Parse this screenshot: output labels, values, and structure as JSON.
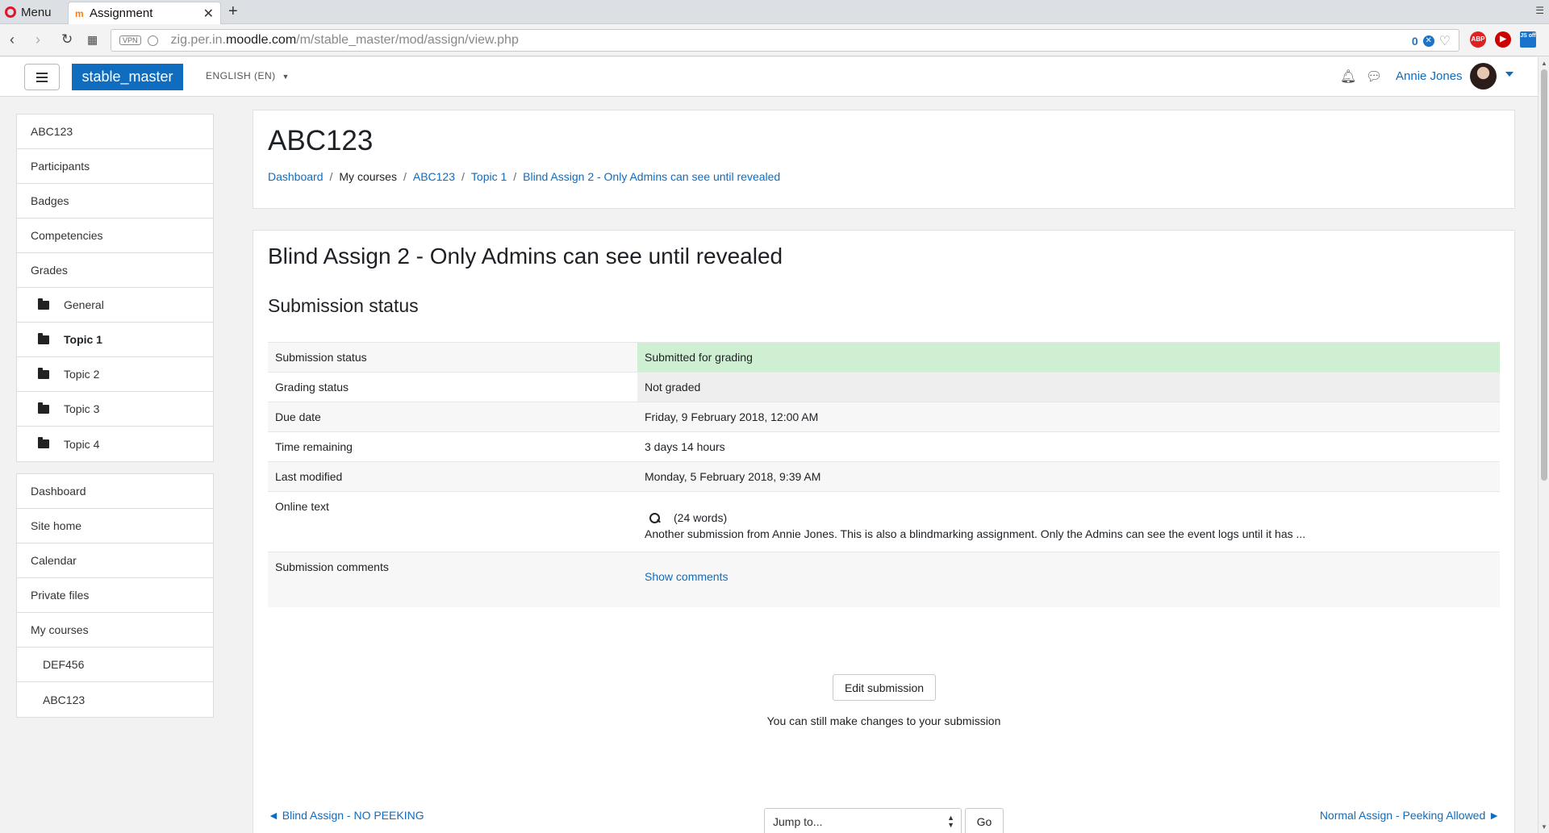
{
  "browser": {
    "menu_label": "Menu",
    "tab_title": "Assignment",
    "url_host_prefix": "zig.per.in.",
    "url_domain": "moodle.com",
    "url_path": "/m/stable_master/mod/assign/view.php",
    "vpn_label": "VPN",
    "blocked_count": "0",
    "ext_abp": "ABP",
    "ext_js": "JS off"
  },
  "navbar": {
    "brand": "stable_master",
    "language": "ENGLISH (EN)",
    "user_name": "Annie Jones"
  },
  "drawer": {
    "course_nav": [
      {
        "label": "ABC123"
      },
      {
        "label": "Participants"
      },
      {
        "label": "Badges"
      },
      {
        "label": "Competencies"
      },
      {
        "label": "Grades"
      },
      {
        "label": "General"
      },
      {
        "label": "Topic 1"
      },
      {
        "label": "Topic 2"
      },
      {
        "label": "Topic 3"
      },
      {
        "label": "Topic 4"
      }
    ],
    "site_nav": [
      {
        "label": "Dashboard"
      },
      {
        "label": "Site home"
      },
      {
        "label": "Calendar"
      },
      {
        "label": "Private files"
      },
      {
        "label": "My courses"
      },
      {
        "label": "DEF456"
      },
      {
        "label": "ABC123"
      }
    ]
  },
  "header": {
    "course_title": "ABC123",
    "breadcrumb": [
      "Dashboard",
      "My courses",
      "ABC123",
      "Topic 1",
      "Blind Assign 2 - Only Admins can see until revealed"
    ],
    "separator": "/"
  },
  "main": {
    "assignment_title": "Blind Assign 2 - Only Admins can see until revealed",
    "section_title": "Submission status",
    "rows": [
      {
        "label": "Submission status",
        "value": "Submitted for grading"
      },
      {
        "label": "Grading status",
        "value": "Not graded"
      },
      {
        "label": "Due date",
        "value": "Friday, 9 February 2018, 12:00 AM"
      },
      {
        "label": "Time remaining",
        "value": "3 days 14 hours"
      },
      {
        "label": "Last modified",
        "value": "Monday, 5 February 2018, 9:39 AM"
      },
      {
        "label": "Online text",
        "word_count": "(24 words)",
        "value": "Another submission from Annie Jones. This is also a blindmarking assignment. Only the Admins can see the event logs until it has ..."
      },
      {
        "label": "Submission comments",
        "value": "Show comments"
      }
    ],
    "edit_button": "Edit submission",
    "edit_note": "You can still make changes to your submission",
    "prev_link": "◄ Blind Assign - NO PEEKING",
    "next_link": "Normal Assign - Peeking Allowed ►",
    "jump_placeholder": "Jump to...",
    "go_button": "Go"
  },
  "colors": {
    "brand_blue": "#0f6cbf",
    "submitted_green": "#cfefd3"
  }
}
